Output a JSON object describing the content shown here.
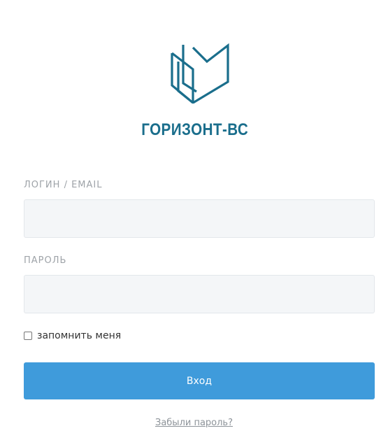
{
  "brand": {
    "name": "ГОРИЗОНТ-ВС",
    "logo_icon": "book-logo-icon",
    "color": "#1a6e8c"
  },
  "form": {
    "login_label": "ЛОГИН / EMAIL",
    "login_value": "",
    "password_label": "ПАРОЛЬ",
    "password_value": "",
    "remember_label": "запомнить меня",
    "remember_checked": false,
    "submit_label": "Вход",
    "submit_color": "#3f9bdb",
    "forgot_label": "Забыли пароль?"
  }
}
